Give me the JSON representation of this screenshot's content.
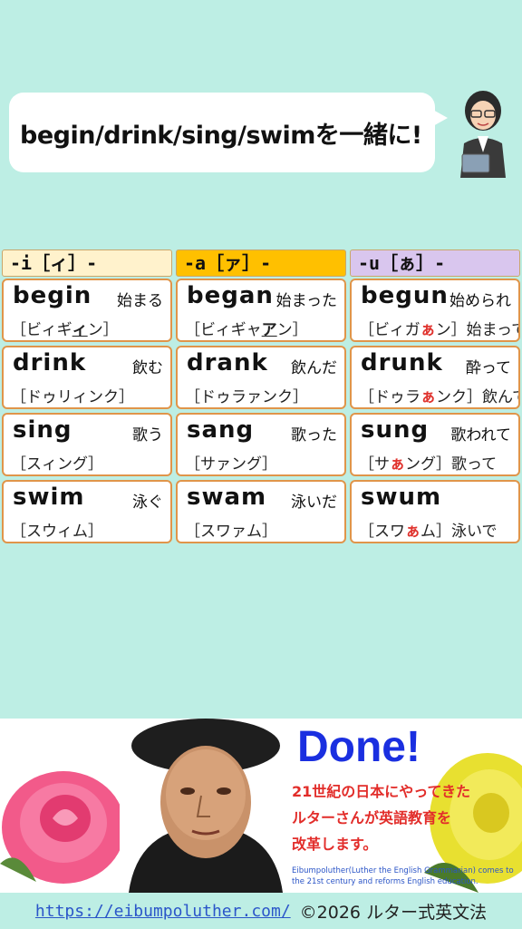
{
  "bubble": {
    "text": "begin/drink/sing/swimを一緒に!"
  },
  "headers": [
    "-i［ィ］-",
    "-a［ァ］-",
    "-u［ぁ］-"
  ],
  "rows": [
    [
      {
        "word": "begin",
        "meaning": "始まる",
        "pron_pre": "［ビィギ",
        "pron_mark": "ィ",
        "pron_post": "ン］"
      },
      {
        "word": "began",
        "meaning": "始まった",
        "pron_pre": "［ビィギャ",
        "pron_mark": "ア",
        "pron_post": "ン］"
      },
      {
        "word": "begun",
        "meaning": "始められ",
        "pron_pre": "［ビィガ",
        "pron_mark": "ぁ",
        "pron_post": "ン］始まって"
      }
    ],
    [
      {
        "word": "drink",
        "meaning": "飲む",
        "pron": "［ドゥリィンク］"
      },
      {
        "word": "drank",
        "meaning": "飲んだ",
        "pron": "［ドゥラァンク］"
      },
      {
        "word": "drunk",
        "meaning": "酔って",
        "pron_pre": "［ドゥラ",
        "pron_mark": "ぁ",
        "pron_post": "ンク］飲んで"
      }
    ],
    [
      {
        "word": "sing",
        "meaning": "歌う",
        "pron": "［スィング］"
      },
      {
        "word": "sang",
        "meaning": "歌った",
        "pron": "［サァング］"
      },
      {
        "word": "sung",
        "meaning": "歌われて",
        "pron_pre": "［サ",
        "pron_mark": "ぁ",
        "pron_post": "ング］歌って"
      }
    ],
    [
      {
        "word": "swim",
        "meaning": "泳ぐ",
        "pron": "［スウィム］"
      },
      {
        "word": "swam",
        "meaning": "泳いだ",
        "pron": "［スワァム］"
      },
      {
        "word": "swum",
        "meaning": "",
        "pron_pre": "［スワ",
        "pron_mark": "ぁ",
        "pron_post": "ム］泳いで"
      }
    ]
  ],
  "banner": {
    "done": "Done!",
    "jp": "21世紀の日本にやってきた\nルターさんが英語教育を\n改革します。",
    "en": "Eibumpoluther(Luther the English Grammarian) comes to the 21st century and reforms English education."
  },
  "footer": {
    "link": "https://eibumpoluther.com/",
    "copyright": "©2026 ルター式英文法"
  }
}
